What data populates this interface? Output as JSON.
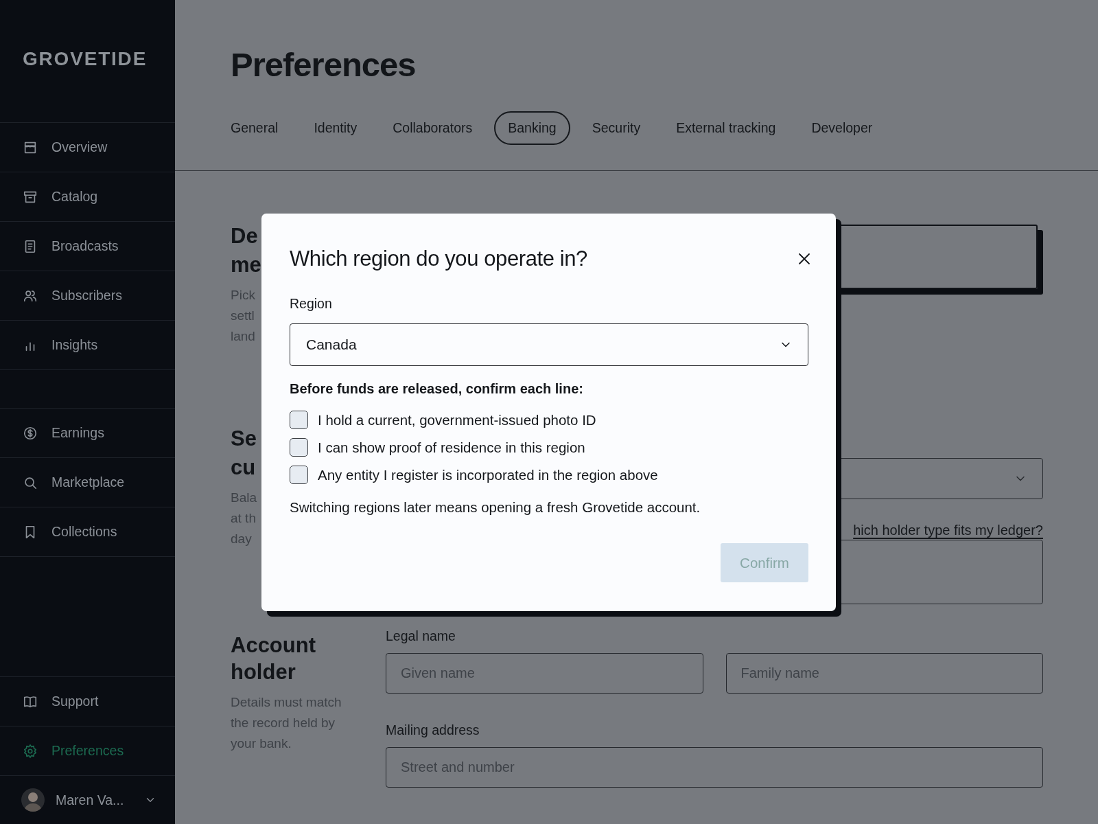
{
  "sidebar": {
    "logo": "GROVETIDE",
    "groups": [
      [
        {
          "label": "Overview",
          "selected": false
        },
        {
          "label": "Catalog",
          "selected": false
        },
        {
          "label": "Broadcasts",
          "selected": false
        },
        {
          "label": "Subscribers",
          "selected": false
        },
        {
          "label": "Insights",
          "selected": false
        }
      ],
      [
        {
          "label": "Earnings",
          "selected": false
        },
        {
          "label": "Marketplace",
          "selected": false
        },
        {
          "label": "Collections",
          "selected": false
        }
      ],
      [
        {
          "label": "Support",
          "selected": false
        },
        {
          "label": "Preferences",
          "selected": true
        }
      ]
    ],
    "user": {
      "name": "Maren Va..."
    }
  },
  "page": {
    "title": "Preferences",
    "tabs": [
      {
        "label": "General",
        "selected": false
      },
      {
        "label": "Identity",
        "selected": false
      },
      {
        "label": "Collaborators",
        "selected": false
      },
      {
        "label": "Banking",
        "selected": true
      },
      {
        "label": "Security",
        "selected": false
      },
      {
        "label": "External tracking",
        "selected": false
      },
      {
        "label": "Developer",
        "selected": false
      }
    ],
    "sections": [
      {
        "heading": [
          "De",
          "me"
        ],
        "description": [
          "Pick",
          "settl",
          "land"
        ],
        "controls": [
          {
            "kind": "panel"
          }
        ]
      },
      {
        "heading": [
          "Se",
          "cu"
        ],
        "description": [
          "Bala",
          "at th",
          "day"
        ],
        "controls": [
          {
            "kind": "select"
          },
          {
            "kind": "link",
            "label": "hich holder type fits my ledger?"
          },
          {
            "kind": "box"
          }
        ]
      },
      {
        "heading": "Account holder",
        "description": "Details must match the record held by your bank.",
        "controls": [
          {
            "kind": "label",
            "text": "Legal name"
          },
          {
            "kind": "field_pair",
            "placeholders": [
              "Given name",
              "Family name"
            ]
          },
          {
            "kind": "label",
            "text": "Mailing address"
          },
          {
            "kind": "field",
            "placeholder": "Street and number"
          }
        ]
      }
    ]
  },
  "dialog": {
    "title": "Which region do you operate in?",
    "field_label": "Region",
    "region": "Canada",
    "checklist_title": "Before funds are released, confirm each line:",
    "checks": [
      {
        "label": "I hold a current, government-issued photo ID",
        "checked": false
      },
      {
        "label": "I can show proof of residence in this region",
        "checked": false
      },
      {
        "label": "Any entity I register is incorporated in the region above",
        "checked": false
      }
    ],
    "note": "Switching regions later means opening a fresh Grovetide account.",
    "confirm": {
      "label": "Confirm",
      "disabled": true
    }
  }
}
